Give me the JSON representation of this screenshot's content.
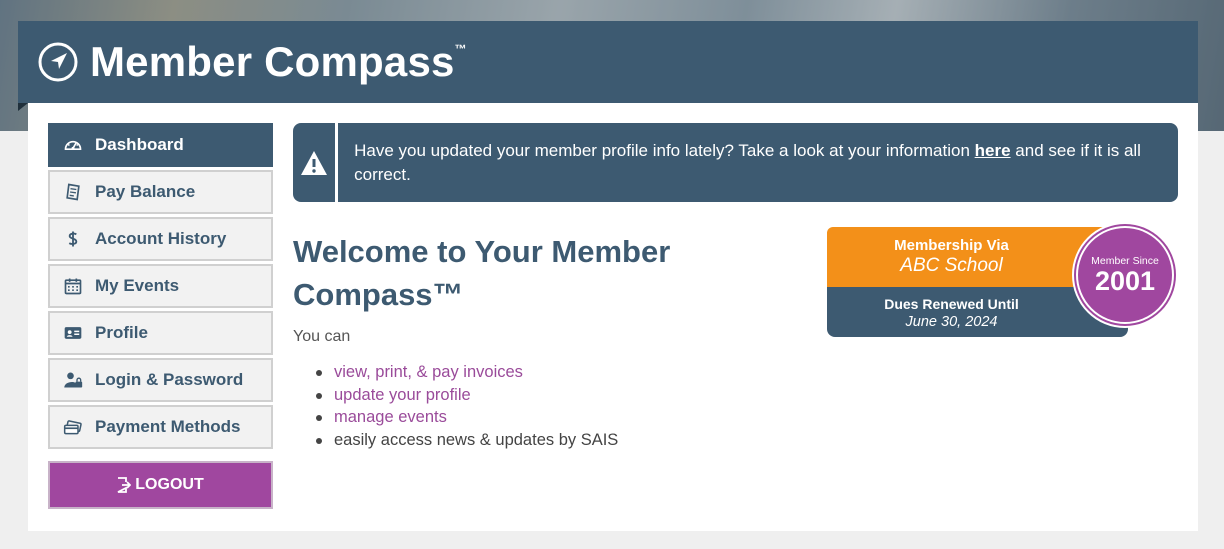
{
  "header": {
    "brand": "Member Compass",
    "trademark": "™"
  },
  "sidebar": {
    "items": [
      {
        "label": "Dashboard",
        "icon": "speedometer-icon",
        "active": true
      },
      {
        "label": "Pay Balance",
        "icon": "receipt-icon"
      },
      {
        "label": "Account History",
        "icon": "dollar-icon"
      },
      {
        "label": "My Events",
        "icon": "calendar-icon"
      },
      {
        "label": "Profile",
        "icon": "id-card-icon"
      },
      {
        "label": "Login & Password",
        "icon": "user-lock-icon"
      },
      {
        "label": "Payment Methods",
        "icon": "credit-card-icon"
      }
    ],
    "logout_label": "LOGOUT"
  },
  "alert": {
    "text_before": "Have you updated your member profile info lately? Take a look at your information ",
    "link_text": "here",
    "text_after": " and see if it is all correct."
  },
  "main": {
    "welcome_title": "Welcome to Your Member Compass™",
    "intro": "You can",
    "list": [
      {
        "text": "view, print, & pay invoices",
        "link": true
      },
      {
        "text": "update your profile",
        "link": true
      },
      {
        "text": "manage events",
        "link": true
      },
      {
        "text": "easily access news & updates by SAIS",
        "link": false
      }
    ]
  },
  "membership": {
    "via_label": "Membership Via",
    "via_value": "ABC School",
    "dues_label": "Dues Renewed Until",
    "dues_value": "June 30, 2024",
    "since_label": "Member Since",
    "since_value": "2001"
  },
  "colors": {
    "primary": "#3d5a71",
    "accent_orange": "#f39019",
    "accent_purple": "#a0479f",
    "link": "#9a4b9a"
  }
}
